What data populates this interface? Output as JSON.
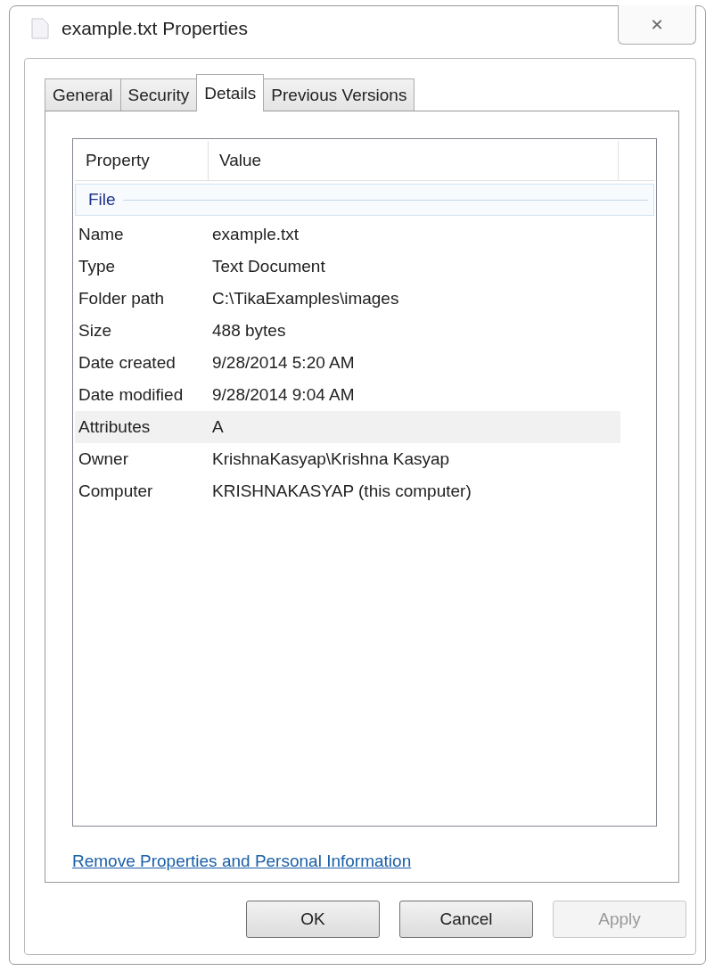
{
  "window": {
    "title": "example.txt Properties",
    "close": "✕"
  },
  "tabs": [
    {
      "label": "General",
      "selected": false
    },
    {
      "label": "Security",
      "selected": false
    },
    {
      "label": "Details",
      "selected": true
    },
    {
      "label": "Previous Versions",
      "selected": false
    }
  ],
  "table": {
    "columns": [
      "Property",
      "Value"
    ],
    "group": "File",
    "rows": [
      {
        "property": "Name",
        "value": "example.txt",
        "selected": false
      },
      {
        "property": "Type",
        "value": "Text Document",
        "selected": false
      },
      {
        "property": "Folder path",
        "value": "C:\\TikaExamples\\images",
        "selected": false
      },
      {
        "property": "Size",
        "value": "488 bytes",
        "selected": false
      },
      {
        "property": "Date created",
        "value": "9/28/2014 5:20 AM",
        "selected": false
      },
      {
        "property": "Date modified",
        "value": "9/28/2014 9:04 AM",
        "selected": false
      },
      {
        "property": "Attributes",
        "value": "A",
        "selected": true
      },
      {
        "property": "Owner",
        "value": "KrishnaKasyap\\Krishna Kasyap",
        "selected": false
      },
      {
        "property": "Computer",
        "value": "KRISHNAKASYAP (this computer)",
        "selected": false
      }
    ]
  },
  "link": "Remove Properties and Personal Information",
  "buttons": [
    {
      "label": "OK",
      "disabled": false
    },
    {
      "label": "Cancel",
      "disabled": false
    },
    {
      "label": "Apply",
      "disabled": true
    }
  ]
}
